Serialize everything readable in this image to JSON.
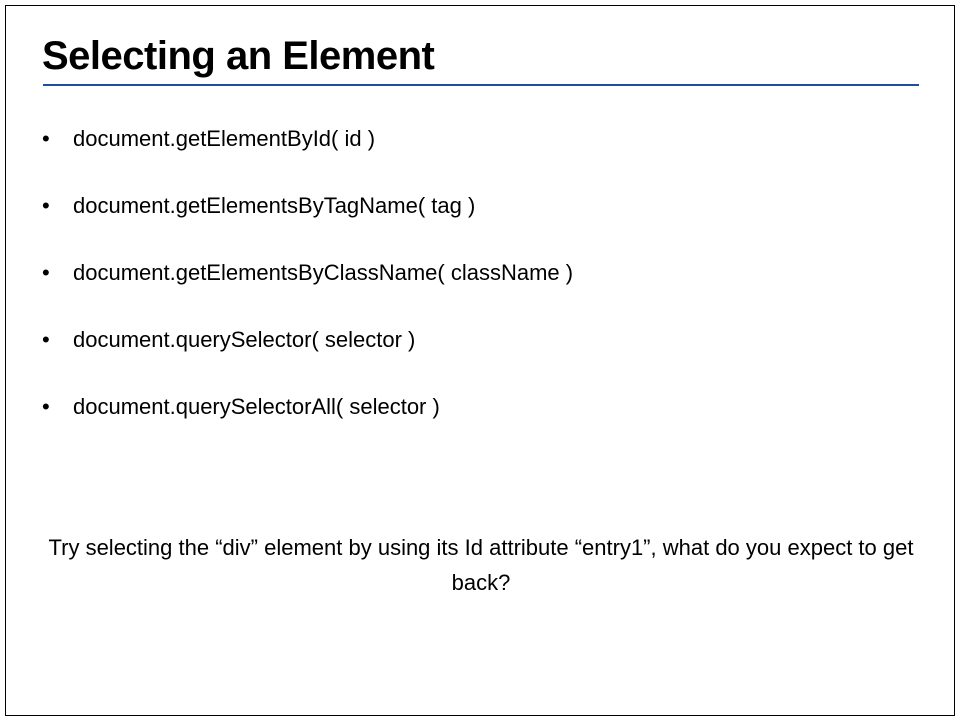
{
  "slide": {
    "title": "Selecting an Element",
    "accent_color": "#1f4e9c",
    "bullet_glyph": "•",
    "bullets": [
      "document.getElementById( id )",
      "document.getElementsByTagName( tag )",
      "document.getElementsByClassName( className )",
      "document.querySelector( selector )",
      "document.querySelectorAll( selector )"
    ],
    "prompt": "Try selecting the “div” element by using its Id attribute “entry1”, what do you expect to get back?"
  }
}
